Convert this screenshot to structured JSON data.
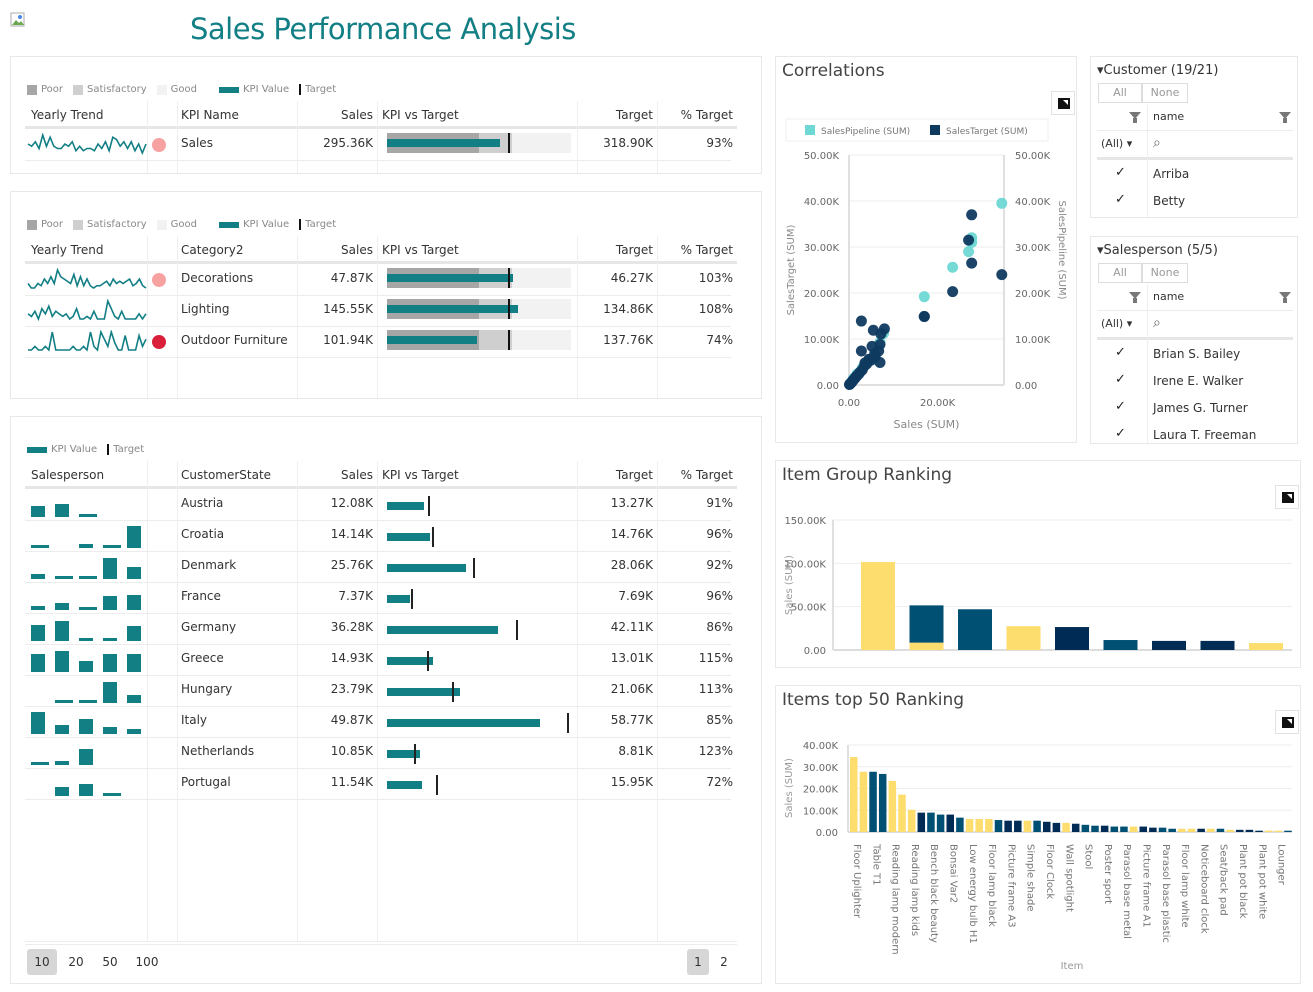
{
  "page": {
    "title": "Sales Performance Analysis"
  },
  "colors": {
    "teal": "#127f85",
    "poor": "#a6a6a6",
    "satisfactory": "#cfcfcf",
    "good": "#f2f2f2",
    "dot_pink": "#f7a1a1",
    "dot_red": "#d91f3a",
    "yellow": "#fddd6e",
    "blue": "#005073",
    "navy": "#002b55",
    "pipeline": "#6ed8d4",
    "target_pt": "#0f3a60"
  },
  "legend": {
    "poor": "Poor",
    "satisfactory": "Satisfactory",
    "good": "Good",
    "kpi_value": "KPI Value",
    "target": "Target"
  },
  "kpi_table": {
    "headers": {
      "trend": "Yearly Trend",
      "name": "KPI Name",
      "sales": "Sales",
      "kpi_vs_target": "KPI vs Target",
      "target": "Target",
      "pct": "% Target"
    },
    "rows": [
      {
        "name": "Sales",
        "sales": "295.36K",
        "target": "318.90K",
        "pct": "93%",
        "status": "pink",
        "kpi_fraction": 0.93,
        "poor_fraction": 0.5,
        "sat_fraction": 0.66,
        "target_fraction": 0.66,
        "trend": [
          5,
          4,
          6,
          3,
          9,
          4,
          8,
          4,
          3,
          3,
          5,
          4,
          6,
          2,
          4,
          2,
          3,
          3,
          2,
          5,
          3,
          6,
          2,
          8,
          7,
          4,
          6,
          3,
          6,
          2,
          5,
          1,
          5
        ]
      }
    ]
  },
  "category_table": {
    "headers": {
      "trend": "Yearly Trend",
      "name": "Category2",
      "sales": "Sales",
      "kpi_vs_target": "KPI vs Target",
      "target": "Target",
      "pct": "% Target"
    },
    "rows": [
      {
        "name": "Decorations",
        "sales": "47.87K",
        "target": "46.27K",
        "pct": "103%",
        "status": "pink",
        "kpi_value": 47.87,
        "target_value": 46.27,
        "trend": [
          3,
          1,
          1,
          3,
          2,
          5,
          3,
          6,
          3,
          9,
          6,
          5,
          4,
          3,
          7,
          2,
          6,
          2,
          5,
          2,
          1,
          2,
          2,
          3,
          4,
          2,
          5,
          3,
          4,
          3,
          4,
          5,
          2,
          3,
          5,
          2,
          1
        ]
      },
      {
        "name": "Lighting",
        "sales": "145.55K",
        "target": "134.86K",
        "pct": "108%",
        "status": "none",
        "kpi_value": 145.55,
        "target_value": 134.86,
        "trend": [
          3,
          2,
          4,
          1,
          5,
          3,
          6,
          2,
          4,
          3,
          2,
          3,
          1,
          2,
          5,
          1,
          1,
          2,
          1,
          4,
          1,
          1,
          1,
          8,
          5,
          2,
          1,
          4,
          1,
          1,
          1,
          1,
          3,
          1,
          3
        ]
      },
      {
        "name": "Outdoor Furniture",
        "sales": "101.94K",
        "target": "137.76K",
        "pct": "74%",
        "status": "red",
        "kpi_value": 101.94,
        "target_value": 137.76,
        "trend": [
          1,
          1,
          2,
          1,
          1,
          2,
          1,
          6,
          1,
          1,
          1,
          1,
          1,
          2,
          1,
          1,
          2,
          1,
          6,
          2,
          1,
          6,
          4,
          2,
          6,
          3,
          1,
          1,
          5,
          1,
          1,
          1,
          5,
          2,
          4
        ]
      }
    ]
  },
  "state_table": {
    "headers": {
      "salesperson": "Salesperson",
      "state": "CustomerState",
      "sales": "Sales",
      "kpi_vs_target": "KPI vs Target",
      "target": "Target",
      "pct": "% Target"
    },
    "max_scale": 60,
    "rows": [
      {
        "state": "Austria",
        "sales": "12.08K",
        "target": "13.27K",
        "pct": "91%",
        "kpi_value": 12.08,
        "target_value": 13.27,
        "spark": [
          0.5,
          0.6,
          0.1,
          0,
          0
        ]
      },
      {
        "state": "Croatia",
        "sales": "14.14K",
        "target": "14.76K",
        "pct": "96%",
        "kpi_value": 14.14,
        "target_value": 14.76,
        "spark": [
          0.12,
          0,
          0.2,
          0.12,
          1.0
        ]
      },
      {
        "state": "Denmark",
        "sales": "25.76K",
        "target": "28.06K",
        "pct": "92%",
        "kpi_value": 25.76,
        "target_value": 28.06,
        "spark": [
          0.25,
          0.1,
          0.05,
          0.95,
          0.55
        ]
      },
      {
        "state": "France",
        "sales": "7.37K",
        "target": "7.69K",
        "pct": "96%",
        "kpi_value": 7.37,
        "target_value": 7.69,
        "spark": [
          0.2,
          0.3,
          0.12,
          0.65,
          0.7
        ]
      },
      {
        "state": "Germany",
        "sales": "36.28K",
        "target": "42.11K",
        "pct": "86%",
        "kpi_value": 36.28,
        "target_value": 42.11,
        "spark": [
          0.75,
          0.9,
          0.15,
          0.15,
          0.7
        ]
      },
      {
        "state": "Greece",
        "sales": "14.93K",
        "target": "13.01K",
        "pct": "115%",
        "kpi_value": 14.93,
        "target_value": 13.01,
        "spark": [
          0.8,
          0.95,
          0.5,
          0.8,
          0.8
        ]
      },
      {
        "state": "Hungary",
        "sales": "23.79K",
        "target": "21.06K",
        "pct": "113%",
        "kpi_value": 23.79,
        "target_value": 21.06,
        "spark": [
          0,
          0.1,
          0.12,
          0.95,
          0.35
        ]
      },
      {
        "state": "Italy",
        "sales": "49.87K",
        "target": "58.77K",
        "pct": "85%",
        "kpi_value": 49.87,
        "target_value": 58.77,
        "spark": [
          1.0,
          0.4,
          0.7,
          0.3,
          0.25
        ]
      },
      {
        "state": "Netherlands",
        "sales": "10.85K",
        "target": "8.81K",
        "pct": "123%",
        "kpi_value": 10.85,
        "target_value": 8.81,
        "spark": [
          0.1,
          0.2,
          0.75,
          0,
          0
        ]
      },
      {
        "state": "Portugal",
        "sales": "11.54K",
        "target": "15.95K",
        "pct": "72%",
        "kpi_value": 11.54,
        "target_value": 15.95,
        "spark": [
          0,
          0.4,
          0.55,
          0.1,
          0
        ]
      }
    ],
    "page_sizes": [
      "10",
      "20",
      "50",
      "100"
    ],
    "active_page_size": "10",
    "pages": [
      "1",
      "2"
    ],
    "active_page": "1"
  },
  "correlations": {
    "title": "Correlations",
    "chart_data": {
      "type": "scatter",
      "title": "Correlations",
      "xlabel": "Sales (SUM)",
      "ylabel": "SalesTarget (SUM)",
      "y2label": "SalesPipeline (SUM)",
      "xlim": [
        0,
        35000
      ],
      "ylim": [
        0,
        50000
      ],
      "x_ticks": [
        "0.00",
        "20.00K"
      ],
      "y_ticks": [
        "0.00",
        "10.00K",
        "20.00K",
        "30.00K",
        "40.00K",
        "50.00K"
      ],
      "legend": [
        "SalesPipeline (SUM)",
        "SalesTarget (SUM)"
      ],
      "series": [
        {
          "name": "SalesPipeline (SUM)",
          "points": [
            [
              34500,
              39500
            ],
            [
              27700,
              32000
            ],
            [
              27700,
              31000
            ],
            [
              27000,
              29000
            ],
            [
              23400,
              25600
            ],
            [
              17000,
              19200
            ],
            [
              7800,
              11200
            ],
            [
              7000,
              9300
            ],
            [
              4400,
              5300
            ],
            [
              3000,
              3700
            ],
            [
              1800,
              2400
            ],
            [
              1000,
              1400
            ],
            [
              500,
              600
            ]
          ]
        },
        {
          "name": "SalesTarget (SUM)",
          "points": [
            [
              27700,
              37000
            ],
            [
              27000,
              31500
            ],
            [
              27700,
              26500
            ],
            [
              34500,
              24000
            ],
            [
              23400,
              20300
            ],
            [
              17000,
              14900
            ],
            [
              17000,
              14900
            ],
            [
              2800,
              13900
            ],
            [
              5500,
              11900
            ],
            [
              8000,
              12200
            ],
            [
              7200,
              11100
            ],
            [
              7000,
              8800
            ],
            [
              5200,
              8400
            ],
            [
              2800,
              7400
            ],
            [
              6700,
              7400
            ],
            [
              5800,
              6800
            ],
            [
              7000,
              4900
            ],
            [
              4500,
              5600
            ],
            [
              4000,
              4600
            ],
            [
              3500,
              4200
            ],
            [
              3000,
              3300
            ],
            [
              2500,
              2800
            ],
            [
              2200,
              2400
            ],
            [
              1800,
              2000
            ],
            [
              1500,
              1700
            ],
            [
              1200,
              1300
            ],
            [
              900,
              1000
            ],
            [
              700,
              700
            ],
            [
              500,
              500
            ],
            [
              300,
              300
            ],
            [
              200,
              200
            ],
            [
              100,
              100
            ],
            [
              5900,
              6200
            ],
            [
              5000,
              5400
            ],
            [
              3600,
              4800
            ]
          ]
        }
      ]
    }
  },
  "customer_slicer": {
    "title": "Customer (19/21)",
    "all_label": "All",
    "none_label": "None",
    "column": "name",
    "filter_value": "(All)",
    "items": [
      {
        "label": "Arriba",
        "checked": true
      },
      {
        "label": "Betty",
        "checked": true
      }
    ]
  },
  "salesperson_slicer": {
    "title": "Salesperson (5/5)",
    "all_label": "All",
    "none_label": "None",
    "column": "name",
    "filter_value": "(All)",
    "items": [
      {
        "label": "Brian S. Bailey",
        "checked": true
      },
      {
        "label": "Irene E. Walker",
        "checked": true
      },
      {
        "label": "James G. Turner",
        "checked": true
      },
      {
        "label": "Laura T. Freeman",
        "checked": true
      }
    ]
  },
  "item_group": {
    "title": "Item Group Ranking",
    "chart_data": {
      "type": "bar",
      "title": "Item Group Ranking",
      "ylabel": "Sales (SUM)",
      "ylim": [
        0,
        150000
      ],
      "y_ticks": [
        "0.00",
        "50.00K",
        "100.00K",
        "150.00K"
      ],
      "bars": [
        {
          "segments": [
            {
              "value": 101500,
              "color": "yellow"
            }
          ]
        },
        {
          "segments": [
            {
              "value": 8500,
              "color": "yellow"
            },
            {
              "value": 43000,
              "color": "blue"
            }
          ]
        },
        {
          "segments": [
            {
              "value": 47000,
              "color": "blue"
            }
          ]
        },
        {
          "segments": [
            {
              "value": 27500,
              "color": "yellow"
            }
          ]
        },
        {
          "segments": [
            {
              "value": 26500,
              "color": "navy"
            }
          ]
        },
        {
          "segments": [
            {
              "value": 11500,
              "color": "blue"
            }
          ]
        },
        {
          "segments": [
            {
              "value": 10500,
              "color": "navy"
            }
          ]
        },
        {
          "segments": [
            {
              "value": 10500,
              "color": "navy"
            }
          ]
        },
        {
          "segments": [
            {
              "value": 8000,
              "color": "yellow"
            }
          ]
        }
      ]
    }
  },
  "items_top50": {
    "title": "Items top 50 Ranking",
    "chart_data": {
      "type": "bar",
      "title": "Items top 50 Ranking",
      "xlabel": "Item",
      "ylabel": "Sales (SUM)",
      "ylim": [
        0,
        40000
      ],
      "y_ticks": [
        "0.00",
        "10.00K",
        "20.00K",
        "30.00K",
        "40.00K"
      ],
      "labels": [
        "Floor Uplighter",
        "Table T1",
        "Reading lamp modern",
        "Reading lamp kids",
        "Bench black beauty",
        "Bonsai Var2",
        "Low energy bulb H1",
        "Floor lamp black",
        "Picture frame A3",
        "Simple shade",
        "Floor Clock",
        "Wall spotlight",
        "Stool",
        "Poster sport",
        "Parasol base metal",
        "Picture frame A1",
        "Parasol base plastic",
        "Floor lamp white",
        "Noticeboard clock",
        "Seat/back pad",
        "Plant pot black",
        "Plant pot white",
        "Lounger"
      ],
      "values": [
        34500,
        27700,
        27700,
        26700,
        23500,
        17200,
        10200,
        8900,
        8900,
        8000,
        8000,
        6600,
        6000,
        6000,
        6000,
        5500,
        5200,
        5200,
        5200,
        5200,
        4700,
        4200,
        4200,
        3800,
        3300,
        2900,
        2900,
        2500,
        2500,
        2500,
        2500,
        2000,
        2000,
        1500,
        1500,
        1500,
        1500,
        1500,
        1500,
        1000,
        1000,
        1000,
        600,
        600,
        600,
        600
      ],
      "colors": [
        "yellow",
        "yellow",
        "blue",
        "blue",
        "yellow",
        "yellow",
        "yellow",
        "navy",
        "blue",
        "blue",
        "navy",
        "blue",
        "yellow",
        "yellow",
        "yellow",
        "blue",
        "navy",
        "navy",
        "yellow",
        "blue",
        "navy",
        "navy",
        "yellow",
        "navy",
        "blue",
        "blue",
        "navy",
        "blue",
        "blue",
        "yellow",
        "navy",
        "navy",
        "blue",
        "blue",
        "yellow",
        "yellow",
        "navy",
        "yellow",
        "blue",
        "yellow",
        "navy",
        "navy",
        "navy",
        "yellow",
        "yellow",
        "blue"
      ]
    }
  }
}
